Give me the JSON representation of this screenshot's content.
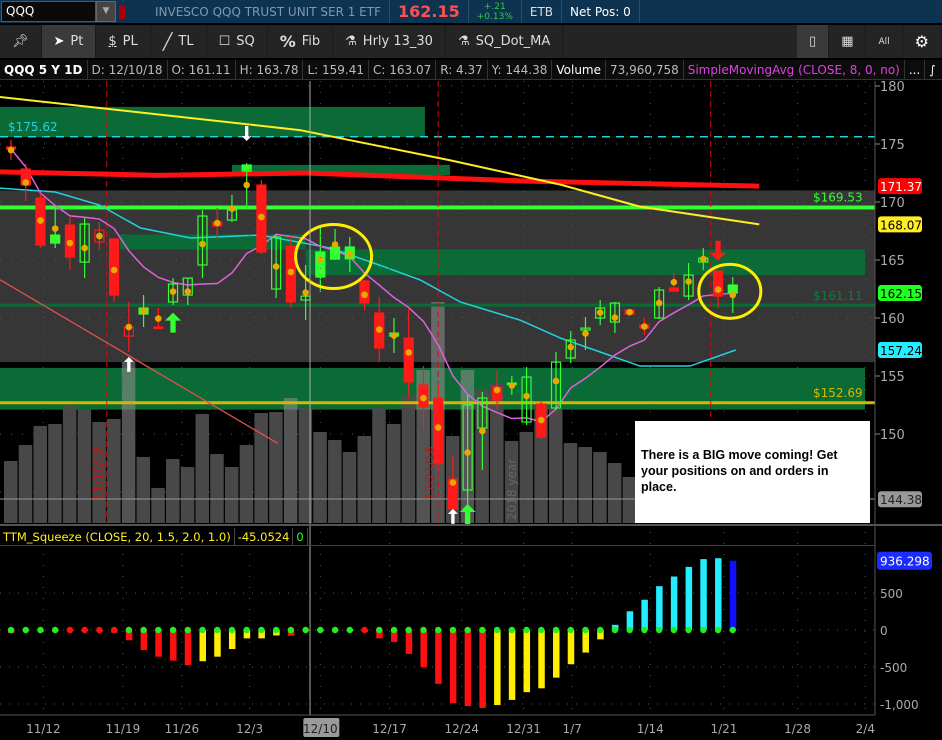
{
  "header": {
    "symbol": "QQQ",
    "description": "INVESCO QQQ TRUST UNIT SER 1 ETF",
    "last": "162.15",
    "change": "+.21",
    "change_pct": "+0.13%",
    "etb": "ETB",
    "net_pos": "Net Pos: 0"
  },
  "toolbar": {
    "pt": "Pt",
    "pl": "PL",
    "tl": "TL",
    "sq": "SQ",
    "fib": "Fib",
    "hrly": "Hrly 13_30",
    "sqdot": "SQ_Dot_MA",
    "all": "All"
  },
  "info": {
    "title": "QQQ 5 Y 1D",
    "date": "D: 12/10/18",
    "open": "O: 161.11",
    "high": "H: 163.78",
    "low": "L: 159.41",
    "close": "C: 163.07",
    "range": "R: 4.37",
    "y": "Y: 144.38",
    "volume_label": "Volume",
    "volume": "73,960,758",
    "study": "SimpleMovingAvg (CLOSE, 8, 0, no)",
    "more": "..."
  },
  "note": "There is a BIG move coming! Get your positions on and orders in place.",
  "squeeze": {
    "label": "TTM_Squeeze (CLOSE, 20, 1.5, 2.0, 1.0)",
    "value": "-45.0524",
    "squeeze_flag": "0"
  },
  "colors": {
    "up": "#33ff33",
    "down": "#ff1a1a",
    "dot": "#e8a800",
    "zone": "#0b6b36",
    "gray_zone": "#363636",
    "sma8": "#e060e0",
    "cyan_ma": "#22d3e0",
    "yellow_ma": "#ffee22",
    "red_ma": "#ff1010"
  },
  "chart_data": {
    "type": "candlestick",
    "price_axis": {
      "ticks": [
        180,
        175,
        170,
        165,
        160,
        155,
        150,
        145
      ],
      "range": [
        141.5,
        180.6
      ]
    },
    "candles": [
      [
        174.74,
        175.34,
        173.62,
        174.57
      ],
      [
        172.84,
        173.27,
        170.08,
        171.46
      ],
      [
        170.34,
        170.77,
        166.03,
        166.29
      ],
      [
        167.15,
        169.39,
        166.03,
        166.46
      ],
      [
        168.01,
        168.79,
        164.13,
        165.25
      ],
      [
        164.82,
        168.62,
        163.44,
        168.1
      ],
      [
        166.55,
        168.27,
        165.86,
        167.58
      ],
      [
        166.81,
        166.89,
        161.38,
        161.98
      ],
      [
        158.44,
        161.38,
        157.07,
        159.22
      ],
      [
        160.86,
        161.98,
        159.22,
        160.34
      ],
      [
        159.22,
        160.86,
        159.05,
        159.13
      ],
      [
        161.38,
        163.44,
        161.12,
        162.93
      ],
      [
        161.98,
        163.44,
        161.12,
        163.44
      ],
      [
        164.57,
        169.31,
        163.44,
        168.79
      ],
      [
        168.27,
        169.48,
        166.89,
        167.93
      ],
      [
        168.44,
        170.6,
        168.27,
        169.31
      ],
      [
        173.19,
        173.36,
        169.57,
        172.67
      ],
      [
        171.46,
        171.89,
        165.51,
        165.69
      ],
      [
        162.5,
        167.15,
        161.72,
        166.98
      ],
      [
        166.2,
        167.07,
        160.86,
        161.38
      ],
      [
        161.55,
        164.57,
        159.82,
        161.89
      ],
      [
        165.69,
        167.84,
        162.24,
        163.53
      ],
      [
        166.12,
        167.67,
        165.0,
        165.08
      ],
      [
        166.12,
        166.98,
        163.96,
        165.1
      ],
      [
        163.19,
        163.3,
        160.69,
        161.29
      ],
      [
        160.43,
        161.81,
        156.2,
        157.41
      ],
      [
        158.7,
        160.0,
        156.98,
        158.44
      ],
      [
        158.27,
        160.86,
        153.19,
        154.48
      ],
      [
        154.22,
        155.86,
        150.34,
        152.32
      ],
      [
        153.1,
        154.22,
        146.89,
        147.5
      ],
      [
        146.12,
        148.1,
        143.53,
        143.53
      ],
      [
        145.17,
        153.36,
        143.44,
        152.5
      ],
      [
        150.51,
        153.62,
        146.89,
        153.1
      ],
      [
        154.05,
        155.51,
        152.07,
        152.93
      ],
      [
        154.39,
        155.0,
        153.36,
        154.3
      ],
      [
        151.03,
        155.77,
        150.77,
        154.91
      ],
      [
        152.58,
        152.93,
        149.48,
        149.74
      ],
      [
        152.24,
        157.07,
        152.07,
        156.2
      ],
      [
        156.55,
        158.88,
        156.12,
        158.1
      ],
      [
        158.96,
        160.08,
        157.24,
        159.13
      ],
      [
        160.0,
        161.55,
        159.39,
        160.86
      ],
      [
        159.65,
        161.38,
        158.7,
        161.29
      ],
      [
        160.69,
        160.8,
        160.2,
        160.34
      ],
      [
        159.39,
        160.0,
        158.53,
        159.13
      ],
      [
        160.0,
        162.67,
        159.91,
        162.41
      ],
      [
        162.58,
        163.88,
        162.3,
        162.32
      ],
      [
        161.89,
        164.74,
        161.55,
        163.7
      ],
      [
        164.82,
        166.03,
        164.13,
        165.17
      ],
      [
        164.05,
        164.05,
        160.86,
        161.89
      ],
      [
        162.84,
        163.53,
        160.43,
        162.15
      ]
    ],
    "volume_millions": [
      50.4,
      63.4,
      78.9,
      80.5,
      95.1,
      92.7,
      82.1,
      84.6,
      130.9,
      53.7,
      28.5,
      52.0,
      45.5,
      88.6,
      56.1,
      45.5,
      63.4,
      89.4,
      90.2,
      101.6,
      93.5,
      74.0,
      67.5,
      57.7,
      70.7,
      93.5,
      80.5,
      103.3,
      124.4,
      179.7,
      70.7,
      124.4,
      108.9,
      113.8,
      66.7,
      74.0,
      95.1,
      93.5,
      65.0,
      61.8,
      57.7,
      48.8,
      37.4
    ],
    "highlighted_volume_bars": [
      8,
      19,
      28,
      29,
      31
    ],
    "sma8_length": 8,
    "yellow_ma": [
      [
        -0.75,
        179.05
      ],
      [
        19.6,
        176.2
      ],
      [
        29.8,
        173.6
      ],
      [
        37.3,
        171.5
      ],
      [
        42.7,
        169.6
      ],
      [
        50.8,
        168.07
      ]
    ],
    "red_ma": [
      [
        -0.75,
        172.6
      ],
      [
        10,
        172.3
      ],
      [
        20,
        172.5
      ],
      [
        35,
        171.8
      ],
      [
        50.8,
        171.37
      ]
    ],
    "cyan_ma": [
      [
        -0.75,
        171.2
      ],
      [
        3,
        170.86
      ],
      [
        6,
        169.74
      ],
      [
        8.8,
        167.76
      ],
      [
        12.2,
        166.9
      ],
      [
        16.9,
        167.15
      ],
      [
        21.7,
        166.03
      ],
      [
        25,
        164.57
      ],
      [
        27.8,
        163.27
      ],
      [
        30.5,
        161.38
      ],
      [
        34.6,
        159.8
      ],
      [
        37.3,
        158.27
      ],
      [
        40,
        157.07
      ],
      [
        42.7,
        155.86
      ],
      [
        46.1,
        155.86
      ],
      [
        49.2,
        157.24
      ]
    ],
    "levels": [
      {
        "price": 175.62,
        "label": "$175.62",
        "style": "cyan-dashed"
      },
      {
        "price": 169.53,
        "label": "$169.53",
        "style": "green"
      },
      {
        "price": 161.11,
        "label": "$161.11",
        "style": "darkgreen"
      },
      {
        "price": 152.69,
        "label": "$152.69",
        "style": "yellow"
      }
    ],
    "zones": [
      {
        "from_bar": -1,
        "to_bar": 28.1,
        "top": 178.2,
        "bottom": 175.6
      },
      {
        "from_bar": 15,
        "to_bar": 29.8,
        "top": 173.2,
        "bottom": 172.3
      },
      {
        "from_bar": 7.4,
        "to_bar": 20,
        "top": 167.2,
        "bottom": 165.9
      },
      {
        "from_bar": 20,
        "to_bar": 58,
        "top": 165.9,
        "bottom": 163.7
      },
      {
        "from_bar": -1,
        "to_bar": 58,
        "top": 155.7,
        "bottom": 152.1
      }
    ],
    "gray_zone": {
      "top": 171.0,
      "bottom": 156.2
    },
    "arrows": [
      {
        "bar": 8,
        "price": 156.0,
        "dir": "up",
        "color": "#ffffff"
      },
      {
        "bar": 16,
        "price": 175.9,
        "dir": "down",
        "color": "#ffffff"
      },
      {
        "bar": 11,
        "price": 159.6,
        "dir": "up",
        "color": "#33ff33"
      },
      {
        "bar": 30,
        "price": 142.9,
        "dir": "up",
        "color": "#ffffff"
      },
      {
        "bar": 31,
        "price": 143.1,
        "dir": "up",
        "color": "#33ff33"
      },
      {
        "bar": 48,
        "price": 165.8,
        "dir": "down",
        "color": "#ff1a1a"
      }
    ],
    "circles": [
      {
        "bar": 21.9,
        "price": 165.3
      },
      {
        "bar": 48.8,
        "price": 162.3
      }
    ],
    "vertical_markers": [
      {
        "bar": 6.5,
        "label": "11/16/18",
        "color": "#cc1010"
      },
      {
        "bar": 29,
        "label": "12/21/18",
        "color": "#cc1010"
      },
      {
        "bar": 47.5,
        "label": "",
        "color": "#cc1010"
      }
    ],
    "year_marker": {
      "bar": 34,
      "label": "2018 year"
    },
    "cursor_bar": 20.3,
    "trendline": [
      [
        -0.75,
        163.3
      ],
      [
        18.1,
        149.2
      ]
    ],
    "badges": [
      {
        "value": "171.37",
        "bg": "#ff0000",
        "fg": "#ffffff",
        "price": 171.37
      },
      {
        "value": "168.07",
        "bg": "#ffee22",
        "fg": "#000000",
        "price": 168.07
      },
      {
        "value": "162.15",
        "bg": "#22ff22",
        "fg": "#000000",
        "price": 162.15
      },
      {
        "value": "157.24",
        "bg": "#22eeff",
        "fg": "#000000",
        "price": 157.24
      },
      {
        "value": "144.38",
        "bg": "#999999",
        "fg": "#222222",
        "price": 144.38
      }
    ],
    "squeeze_axis": {
      "ticks": [
        {
          "v": 500,
          "label": "500"
        },
        {
          "v": 0,
          "label": "0"
        },
        {
          "v": -500,
          "label": "-500"
        },
        {
          "v": -1000,
          "label": "-1,000"
        }
      ],
      "badge": "936.298"
    },
    "squeeze_hist": [
      -43,
      -5,
      -26,
      -5,
      -5,
      -10,
      -20,
      -38,
      -139,
      -270,
      -361,
      -414,
      -475,
      -422,
      -361,
      -257,
      -113,
      -113,
      -74,
      -78,
      -10,
      -5,
      -5,
      -5,
      -26,
      -113,
      -161,
      -322,
      -505,
      -727,
      -988,
      -1027,
      -1053,
      -1014,
      -945,
      -840,
      -788,
      -644,
      -462,
      -305,
      -126,
      70,
      253,
      409,
      592,
      723,
      853,
      958,
      970,
      936
    ],
    "squeeze_red_dots": [
      4,
      5,
      6,
      7,
      24
    ],
    "dates": [
      {
        "label": "11/12",
        "bar": 2.2
      },
      {
        "label": "11/19",
        "bar": 7.6
      },
      {
        "label": "11/26",
        "bar": 11.6
      },
      {
        "label": "12/3",
        "bar": 16.2
      },
      {
        "label": "12/10",
        "bar": 21,
        "highlight": true
      },
      {
        "label": "12/17",
        "bar": 25.7
      },
      {
        "label": "12/24",
        "bar": 30.6
      },
      {
        "label": "12/31",
        "bar": 34.8
      },
      {
        "label": "1/7",
        "bar": 38.1
      },
      {
        "label": "1/14",
        "bar": 43.4
      },
      {
        "label": "1/21",
        "bar": 48.4
      },
      {
        "label": "1/28",
        "bar": 53.4
      },
      {
        "label": "2/4",
        "bar": 58
      }
    ]
  }
}
